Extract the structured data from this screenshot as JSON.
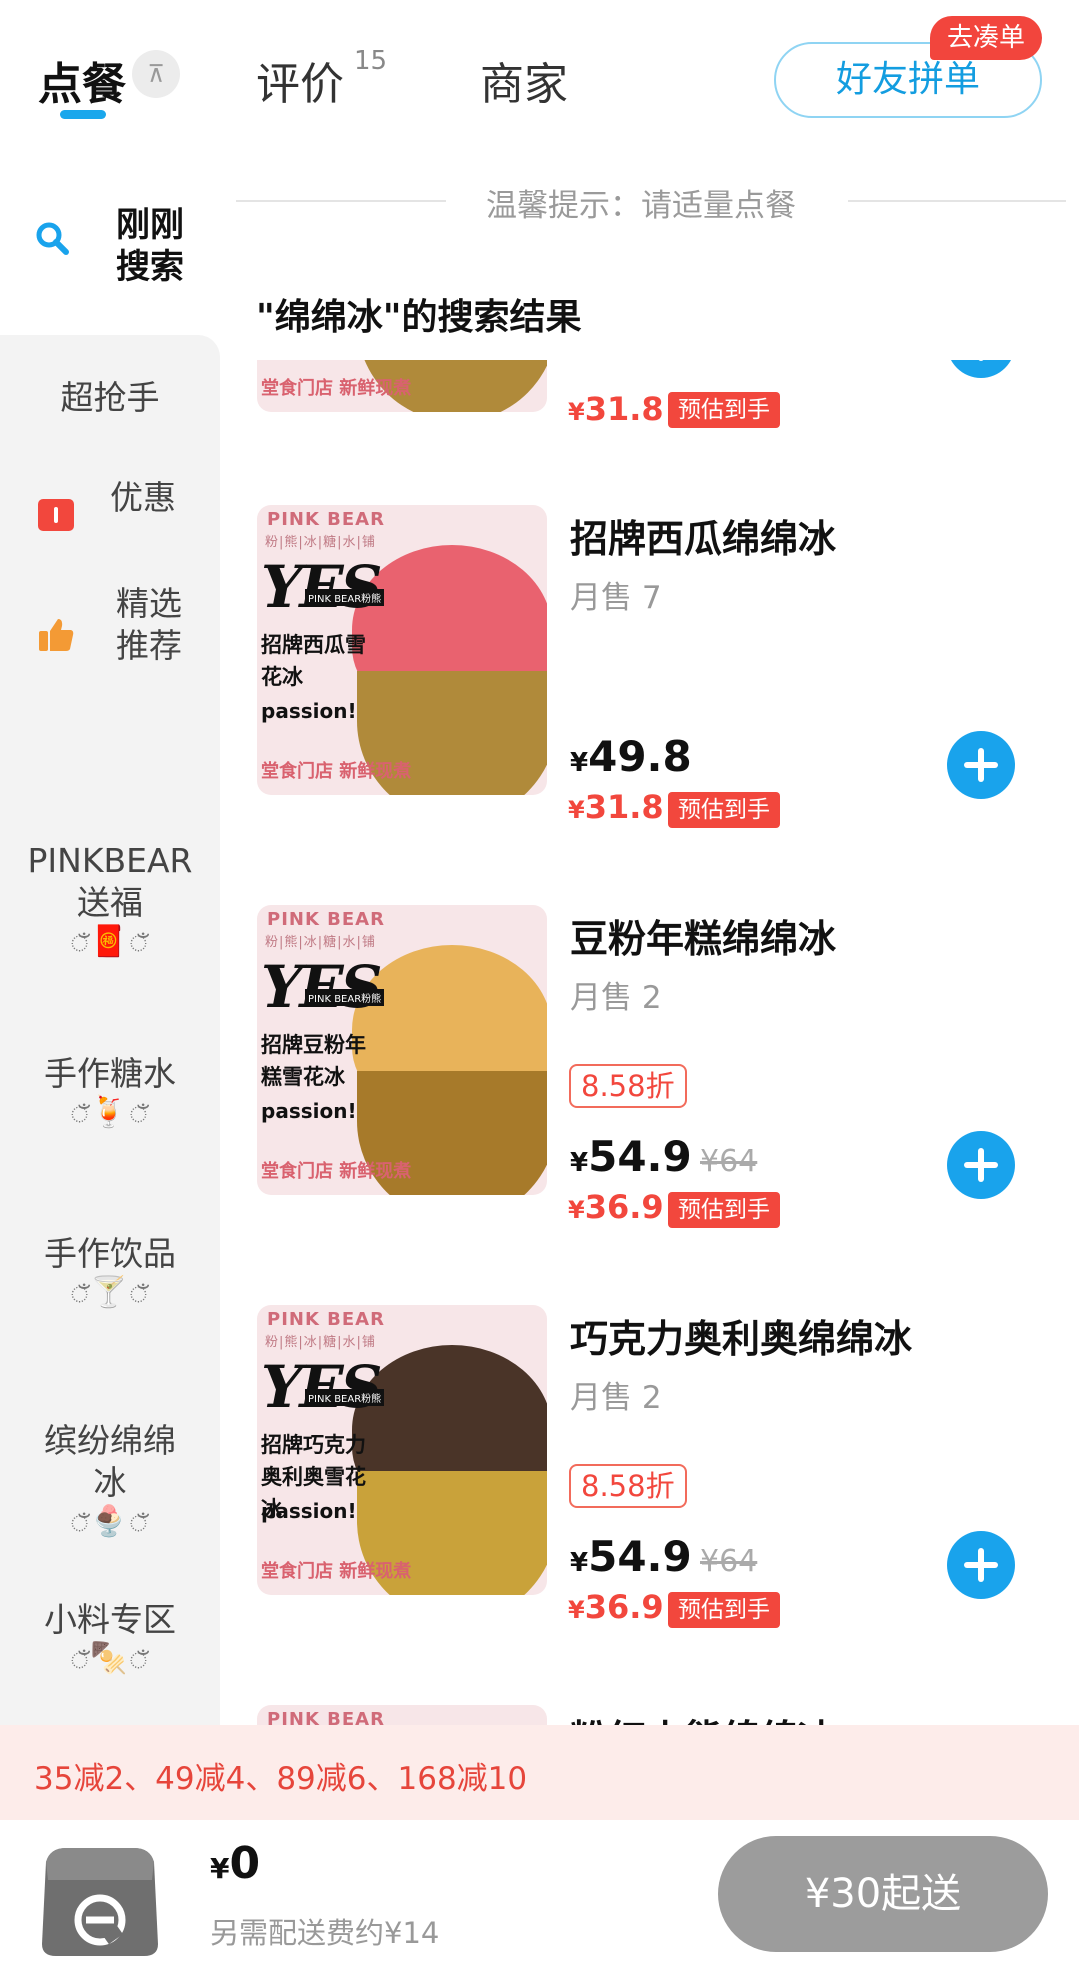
{
  "tabs": {
    "order": "点餐",
    "pin": "⊼",
    "review": "评价",
    "review_count": "15",
    "shop": "商家",
    "group_order": "好友拼单",
    "group_badge": "去凑单"
  },
  "sidebar": {
    "search_label": "刚刚搜索",
    "items": [
      {
        "label": "超抢手"
      },
      {
        "label": "优惠"
      },
      {
        "label": "精选推荐"
      },
      {
        "label": "PINKBEAR送福",
        "deco": "🧧"
      },
      {
        "label": "手作糖水",
        "deco": "🍹"
      },
      {
        "label": "手作饮品",
        "deco": "🍸"
      },
      {
        "label": "缤纷绵绵冰",
        "deco": "🍨"
      },
      {
        "label": "小料专区",
        "deco": "🍢"
      }
    ]
  },
  "tip": "温馨提示：请适量点餐",
  "result_title": "\"绵绵冰\"的搜索结果",
  "products": [
    {
      "name": "",
      "final_price": "31.8",
      "est_label": "预估到手"
    },
    {
      "name": "招牌西瓜绵绵冰",
      "sales": "月售 7",
      "price": "49.8",
      "final_price": "31.8",
      "est_label": "预估到手",
      "thumb_name": "招牌西瓜雪花冰",
      "colors": {
        "ice": "#e9626f",
        "bowl": "#b08a3a"
      }
    },
    {
      "name": "豆粉年糕绵绵冰",
      "sales": "月售 2",
      "discount": "8.58折",
      "price": "54.9",
      "orig_price": "¥64",
      "final_price": "36.9",
      "est_label": "预估到手",
      "thumb_name": "招牌豆粉年糕雪花冰",
      "colors": {
        "ice": "#e8b35a",
        "bowl": "#a77a2a"
      }
    },
    {
      "name": "巧克力奥利奥绵绵冰",
      "sales": "月售 2",
      "discount": "8.58折",
      "price": "54.9",
      "orig_price": "¥64",
      "final_price": "36.9",
      "est_label": "预估到手",
      "thumb_name": "招牌巧克力奥利奥雪花冰",
      "colors": {
        "ice": "#4a3428",
        "bowl": "#c9a23a"
      }
    },
    {
      "name": "粉红小熊绵绵冰"
    }
  ],
  "thumb_common": {
    "brand": "PINK BEAR",
    "sub": "粉|熊|冰|糖|水|铺",
    "yes": "YES",
    "tag": "PINK BEAR粉熊",
    "passion": "passion!",
    "foot": "堂食门店 新鲜现煮"
  },
  "promo": "35减2、49减4、89减6、168减10",
  "cart": {
    "currency": "¥",
    "total": "0",
    "fee_note": "另需配送费约¥14",
    "checkout": "¥30起送"
  },
  "accent_color": "#19a3ec",
  "price_color": "#f2473d"
}
